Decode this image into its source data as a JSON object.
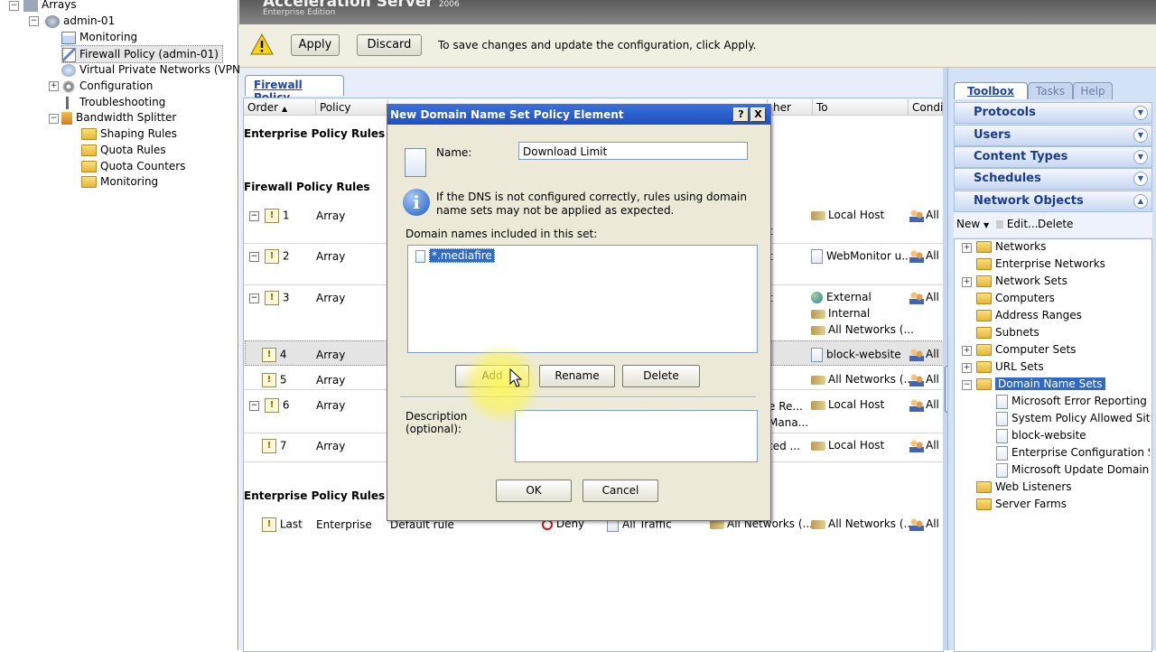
{
  "left_tree": {
    "items": [
      {
        "label": "Arrays"
      },
      {
        "label": "admin-01"
      },
      {
        "label": "Monitoring"
      },
      {
        "label": "Firewall Policy (admin-01)"
      },
      {
        "label": "Virtual Private Networks (VPN)"
      },
      {
        "label": "Configuration"
      },
      {
        "label": "Troubleshooting"
      },
      {
        "label": "Bandwidth Splitter"
      },
      {
        "label": "Shaping Rules"
      },
      {
        "label": "Quota Rules"
      },
      {
        "label": "Quota Counters"
      },
      {
        "label": "Monitoring"
      }
    ]
  },
  "banner": {
    "title": "Acceleration Server",
    "year": "2006",
    "edition": "Enterprise Edition"
  },
  "applybar": {
    "apply": "Apply",
    "discard": "Discard",
    "message": "To save changes and update the configuration, click Apply."
  },
  "main": {
    "tab": "Firewall Policy",
    "columns": [
      "Order",
      "Policy",
      "her",
      "To",
      "Condi"
    ],
    "sections": {
      "enterprise_top": "Enterprise Policy Rules Ap",
      "firewall": "Firewall Policy Rules",
      "enterprise_bottom": "Enterprise Policy Rules Ap"
    },
    "rules": [
      {
        "order": "1",
        "policy": "Array",
        "other": "t",
        "to": [
          "Local Host"
        ],
        "cond": "All"
      },
      {
        "order": "2",
        "policy": "Array",
        "other": "t",
        "to": [
          "WebMonitor u..."
        ],
        "cond": "All"
      },
      {
        "order": "3",
        "policy": "Array",
        "other": "t",
        "to": [
          "External",
          "Internal",
          "All Networks (..."
        ],
        "cond": "All"
      },
      {
        "order": "4",
        "policy": "Array",
        "other": "",
        "to": [
          "block-website"
        ],
        "cond": "All"
      },
      {
        "order": "5",
        "policy": "Array",
        "other": "",
        "to": [
          "All Networks (..."
        ],
        "cond": "All"
      },
      {
        "order": "6",
        "policy": "Array",
        "other": "e Re...\nMana...",
        "to": [
          "Local Host"
        ],
        "cond": "All"
      },
      {
        "order": "7",
        "policy": "Array",
        "other": "ted ...",
        "to": [
          "Local Host"
        ],
        "cond": "All"
      }
    ],
    "last_rule": {
      "order": "Last",
      "policy": "Enterprise",
      "name": "Default rule",
      "action": "Deny",
      "protocols": "All Traffic",
      "from": "All Networks (...",
      "to": "All Networks (...",
      "cond": "All"
    }
  },
  "right": {
    "tabs": [
      "Toolbox",
      "Tasks",
      "Help"
    ],
    "sections": [
      "Protocols",
      "Users",
      "Content Types",
      "Schedules",
      "Network Objects"
    ],
    "toolbar": {
      "new": "New",
      "edit": "Edit...",
      "delete": "Delete"
    },
    "tree": [
      {
        "label": "Networks"
      },
      {
        "label": "Enterprise Networks"
      },
      {
        "label": "Network Sets"
      },
      {
        "label": "Computers"
      },
      {
        "label": "Address Ranges"
      },
      {
        "label": "Subnets"
      },
      {
        "label": "Computer Sets"
      },
      {
        "label": "URL Sets"
      },
      {
        "label": "Domain Name Sets"
      },
      {
        "label": "Microsoft Error Reporting Si"
      },
      {
        "label": "System Policy Allowed Sites"
      },
      {
        "label": "block-website"
      },
      {
        "label": "Enterprise Configuration Sto"
      },
      {
        "label": "Microsoft Update Domain Na"
      },
      {
        "label": "Web Listeners"
      },
      {
        "label": "Server Farms"
      }
    ]
  },
  "dialog": {
    "title": "New Domain Name Set Policy Element",
    "help_btn": "?",
    "close_btn": "X",
    "name_label": "Name:",
    "name_value": "Download Limit",
    "info": "If the DNS is not configured correctly, rules using domain name sets may not be applied as expected.",
    "list_label": "Domain names included in this set:",
    "domains": [
      "*.mediafire"
    ],
    "add": "Add",
    "rename": "Rename",
    "delete": "Delete",
    "desc_label": "Description (optional):",
    "ok": "OK",
    "cancel": "Cancel"
  },
  "colors": {
    "accent": "#1d44a8",
    "title_bar": "#2458c9",
    "panel": "#e8eef9"
  }
}
